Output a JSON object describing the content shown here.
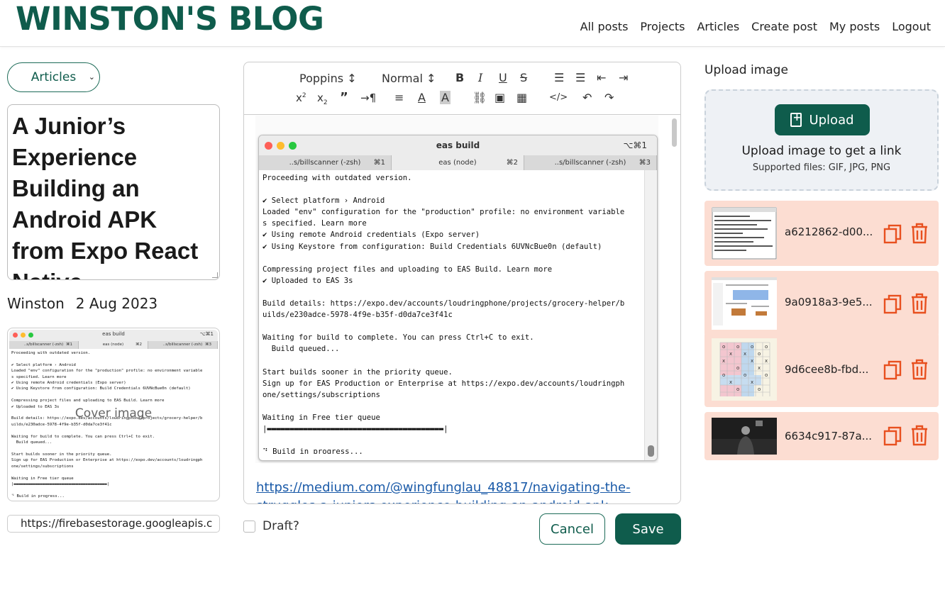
{
  "header": {
    "brand": "WINSTON'S BLOG",
    "nav": [
      "All posts",
      "Projects",
      "Articles",
      "Create post",
      "My posts",
      "Logout"
    ]
  },
  "post": {
    "category": "Articles",
    "title": "A Junior’s Experience Building an Android APK from Expo React Native",
    "author": "Winston",
    "date": "2 Aug 2023",
    "cover_label": "Cover image",
    "cover_url": "https://firebasestorage.googleapis.c"
  },
  "editor": {
    "font": "Poppins",
    "size": "Normal",
    "link_text": "https://medium.com/@wingfunglau_48817/navigating-the-struggles-a-juniors-experience-building-an-android-apk"
  },
  "terminal": {
    "title": "eas build",
    "shortcut": "⌥⌘1",
    "tabs": [
      {
        "label": "..s/billscanner (-zsh)",
        "key": "⌘1"
      },
      {
        "label": "eas (node)",
        "key": "⌘2"
      },
      {
        "label": "..s/billscanner (-zsh)",
        "key": "⌘3"
      }
    ],
    "lines": [
      "Proceeding with outdated version.",
      "",
      "✔ Select platform › Android",
      "Loaded \"env\" configuration for the \"production\" profile: no environment variable",
      "s specified. Learn more",
      "✔ Using remote Android credentials (Expo server)",
      "✔ Using Keystore from configuration: Build Credentials 6UVNcBue0n (default)",
      "",
      "Compressing project files and uploading to EAS Build. Learn more",
      "✔ Uploaded to EAS 3s",
      "",
      "Build details: https://expo.dev/accounts/loudringphone/projects/grocery-helper/b",
      "uilds/e230adce-5978-4f9e-b35f-d0da7ce3f41c",
      "",
      "Waiting for build to complete. You can press Ctrl+C to exit.",
      "  Build queued...",
      "",
      "Start builds sooner in the priority queue.",
      "Sign up for EAS Production or Enterprise at https://expo.dev/accounts/loudringph",
      "one/settings/subscriptions",
      "",
      "Waiting in Free tier queue",
      "|▬▬▬▬▬▬▬▬▬▬▬▬▬▬▬▬▬▬▬▬▬▬▬▬▬▬▬▬▬▬▬▬▬▬▬▬▬▬▬|",
      "",
      "⠙ Build in progress..."
    ]
  },
  "actions": {
    "draft_label": "Draft?",
    "cancel": "Cancel",
    "save": "Save"
  },
  "upload": {
    "title": "Upload image",
    "button": "Upload",
    "heading": "Upload image to get a link",
    "supported": "Supported files: GIF, JPG, PNG"
  },
  "images": [
    {
      "name": "a6212862-d00...",
      "thumb": "document"
    },
    {
      "name": "9a0918a3-9e5...",
      "thumb": "dashboard"
    },
    {
      "name": "9d6cee8b-fbd...",
      "thumb": "grid"
    },
    {
      "name": "6634c917-87a...",
      "thumb": "photo"
    }
  ],
  "colors": {
    "brand": "#0f5c4c",
    "row_bg": "#fcddd2",
    "icon_orange": "#e8501f",
    "link": "#1a5aa8"
  }
}
